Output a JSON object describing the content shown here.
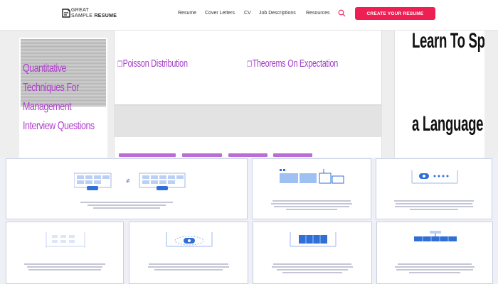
{
  "brand": {
    "line1": "GREAT",
    "line2a": "SAMPLE",
    "line2b": "RESUME",
    "accent": "#ee1f53",
    "purple": "#a33dc8"
  },
  "nav": {
    "items": [
      "Resume",
      "Cover Letters",
      "CV",
      "Job Descriptions",
      "Resources"
    ],
    "cta_label": "CREATE YOUR RESUME"
  },
  "sidebar": {
    "title": "Quantitative Techniques For Management Interview Questions"
  },
  "topics": [
    {
      "icon": "link-icon",
      "label": "Poisson Distribution"
    },
    {
      "icon": "link-icon",
      "label": "Theorems On Expectation"
    }
  ],
  "ad": {
    "line1": "Learn To Speak",
    "line2": "a Language"
  },
  "diagram_grid": {
    "tiles": [
      {
        "title": "",
        "has_title": false
      },
      {
        "title": "",
        "has_title": false
      },
      {
        "title": "",
        "has_title": false
      },
      {
        "title": "",
        "has_title": false
      },
      {
        "title": "",
        "has_title": false
      },
      {
        "title": "",
        "has_title": false
      },
      {
        "title": "",
        "has_title": false
      }
    ]
  }
}
